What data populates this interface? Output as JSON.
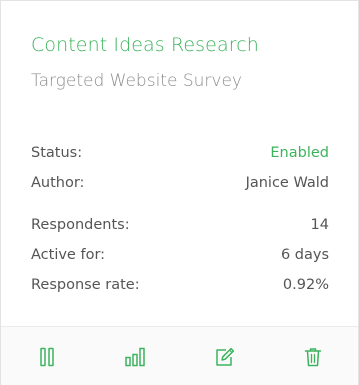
{
  "card": {
    "title": "Content Ideas Research",
    "subtitle": "Targeted Website Survey"
  },
  "details": {
    "status_label": "Status:",
    "status_value": "Enabled",
    "author_label": "Author:",
    "author_value": "Janice Wald",
    "respondents_label": "Respondents:",
    "respondents_value": "14",
    "active_label": "Active for:",
    "active_value": "6 days",
    "response_rate_label": "Response rate:",
    "response_rate_value": "0.92%"
  },
  "actions": [
    {
      "icon": "pause-icon",
      "name": "pause-button"
    },
    {
      "icon": "bar-chart-icon",
      "name": "results-button"
    },
    {
      "icon": "edit-icon",
      "name": "edit-button"
    },
    {
      "icon": "trash-icon",
      "name": "delete-button"
    }
  ],
  "colors": {
    "accent": "#3cb35c",
    "muted": "#8c8c8c",
    "text": "#555555"
  }
}
